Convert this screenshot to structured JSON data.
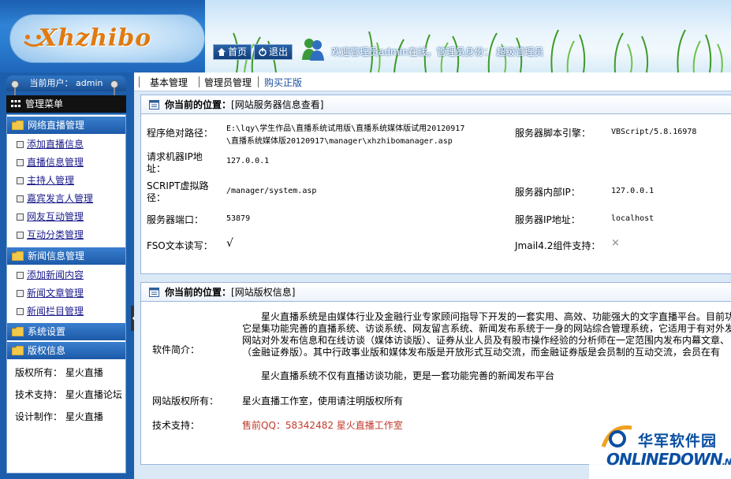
{
  "header": {
    "logo_text": "Xhzhibo",
    "home_label": "首页",
    "logout_label": "退出",
    "welcome": "欢迎管理员admin在线，管理员身份： 超级管理员"
  },
  "sidebar": {
    "current_user": "当前用户： admin",
    "menu_title": "管理菜单",
    "sections": [
      {
        "title": "网络直播管理",
        "items": [
          "添加直播信息",
          "直播信息管理",
          "主持人管理",
          "嘉宾发言人管理",
          "网友互动管理",
          "互动分类管理"
        ]
      },
      {
        "title": "新闻信息管理",
        "items": [
          "添加新闻内容",
          "新闻文章管理",
          "新闻栏目管理"
        ]
      },
      {
        "title": "系统设置",
        "items": []
      },
      {
        "title": "版权信息",
        "items": []
      }
    ],
    "copyright_lines": [
      "版权所有：  星火直播",
      "技术支持：  星火直播论坛",
      "设计制作：  星火直播"
    ]
  },
  "topnav": [
    "基本管理",
    "管理员管理",
    "购买正版"
  ],
  "server_panel": {
    "title_bold": "你当前的位置：",
    "title_rest": "[网站服务器信息查看]",
    "rows": [
      {
        "label": "程序绝对路径：",
        "value_line1": "E:\\lqy\\学生作品\\直播系统试用版\\直播系统媒体版试用20120917",
        "value_line2": "\\直播系统媒体版20120917\\manager\\xhzhibomanager.asp",
        "label2": "服务器脚本引擎：",
        "value2": "VBScript/5.8.16978"
      },
      {
        "label_line1": "请求机器IP地",
        "label_line2": "址：",
        "value": "127.0.0.1"
      },
      {
        "label_line1": "SCRIPT虚拟路",
        "label_line2": "径：",
        "value": "/manager/system.asp",
        "label2": "服务器内部IP：",
        "value2": "127.0.0.1"
      },
      {
        "label": "服务器端口：",
        "value": "53879",
        "label2": "服务器IP地址：",
        "value2": "localhost"
      },
      {
        "label": "FSO文本读写：",
        "value": "√",
        "label2": "Jmail4.2组件支持：",
        "value2": "×"
      }
    ]
  },
  "copyright_panel": {
    "title_bold": "你当前的位置：",
    "title_rest": "[网站版权信息]",
    "intro_label": "软件简介：",
    "intro_lines": [
      "星火直播系统是由媒体行业及金融行业专家顾问指导下开发的一套实用、高效、功能强大的文字直播平台。目前功",
      "它是集功能完善的直播系统、访谈系统、网友留言系统、新闻发布系统于一身的网站综合管理系统，它适用于有对外发",
      "网站对外发布信息和在线访谈（媒体访谈版）、证券从业人员及有股市操作经验的分析师在一定范围内发布内幕文章、",
      "（金融证券版）。其中行政事业版和媒体发布版是开放形式互动交流，而金融证券版是会员制的互动交流，会员在有",
      "星火直播系统不仅有直播访谈功能，更是一套功能完善的新闻发布平台"
    ],
    "owner_label": "网站版权所有：",
    "owner_value": "星火直播工作室，使用请注明版权所有",
    "support_label": "技术支持：",
    "support_value": "售前QQ：58342482 星火直播工作室"
  },
  "watermark": {
    "cn": "华军软件园",
    "en": "ONLINEDOWN",
    "suffix": ".NET"
  }
}
